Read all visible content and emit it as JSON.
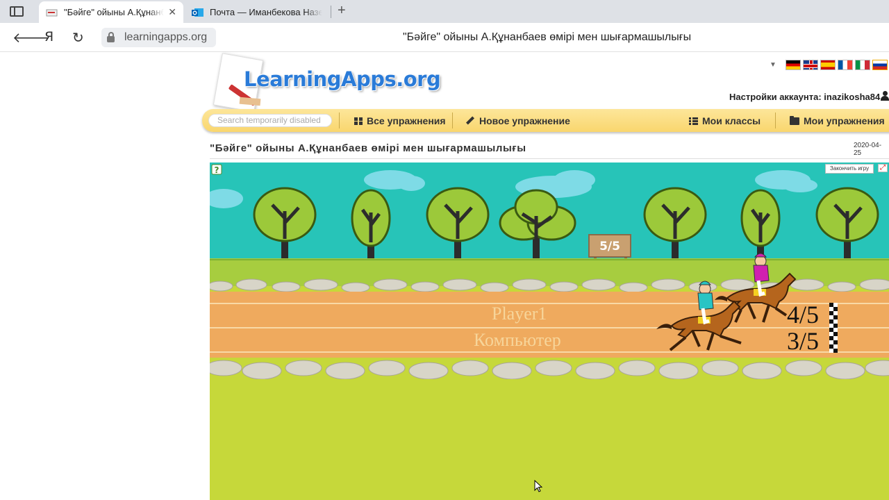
{
  "browser": {
    "tabs": [
      {
        "title": "\"Бәйге\" ойыны А.Құнанбаев өмірі",
        "active": true
      },
      {
        "title": "Почта — Иманбекова Назерке",
        "active": false
      }
    ],
    "url": "learningapps.org",
    "page_title": "\"Бәйге\" ойыны А.Құнанбаев өмірі мен шығармашылығы"
  },
  "site": {
    "logo_text": "LearningApps.org",
    "account_label": "Настройки аккаунта: inazikosha84",
    "languages": [
      "de",
      "gb",
      "es",
      "fr",
      "it",
      "ru"
    ],
    "search_placeholder": "Search temporarily disabled",
    "nav": {
      "all_exercises": "Все упражнения",
      "new_exercise": "Новое упражнение",
      "my_classes": "Мои классы",
      "my_exercises": "Мои упражнения"
    },
    "accent_color": "#fbdc7c"
  },
  "exercise": {
    "title": "\"Бәйге\" ойыны А.Құнанбаев өмірі мен шығармашылығы",
    "date": "2020-04-25"
  },
  "game": {
    "finish_button": "Закончить игру",
    "score_sign": "5/5",
    "players": [
      {
        "label": "Player1",
        "score": "4/5"
      },
      {
        "label": "Компьютер",
        "score": "3/5"
      }
    ],
    "colors": {
      "sky": "#27c4b8",
      "grass": "#c6d83a",
      "track": "#efaa5e"
    }
  }
}
